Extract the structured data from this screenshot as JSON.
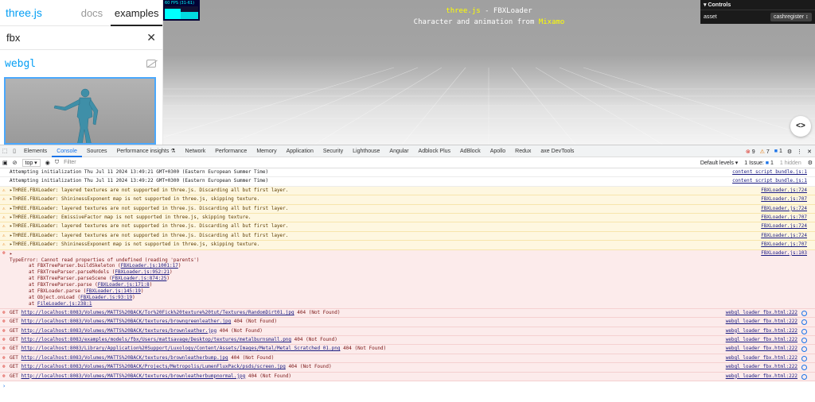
{
  "sidebar": {
    "brand": "three.js",
    "tabs": {
      "docs": "docs",
      "examples": "examples"
    },
    "search_value": "fbx",
    "clear_icon": "close-icon",
    "category": "webgl"
  },
  "viewport": {
    "title_brand": "three.js",
    "title_rest": " - FBXLoader",
    "subtitle_prefix": "Character and animation from ",
    "subtitle_link": "Mixamo",
    "stats": "60 FPS (31-61)",
    "gui": {
      "title": "Controls",
      "label": "asset",
      "value": "cashregister ↕"
    },
    "code_button": "<>"
  },
  "devtools": {
    "tabs": [
      "Elements",
      "Console",
      "Sources",
      "Performance insights ⚗",
      "Network",
      "Performance",
      "Memory",
      "Application",
      "Security",
      "Lighthouse",
      "Angular",
      "Adblock Plus",
      "AdBlock",
      "Apollo",
      "Redux",
      "axe DevTools"
    ],
    "active_tab": "Console",
    "error_count": "9",
    "warning_count": "7",
    "info_count": "1",
    "filterbar": {
      "context": "top ▾",
      "filter_placeholder": "Filter",
      "levels": "Default levels ▾",
      "issues": "1 Issue:",
      "issues_count": "1",
      "hidden": "1 hidden"
    },
    "logs": [
      {
        "text": "Attempting initialization Thu Jul 11 2024 13:49:21 GMT+0300 (Eastern European Summer Time)",
        "src": "content_script_bundle.js:1"
      },
      {
        "text": "Attempting initialization Thu Jul 11 2024 13:49:22 GMT+0300 (Eastern European Summer Time)",
        "src": "content_script_bundle.js:1"
      }
    ],
    "warnings": [
      {
        "text": "▸THREE.FBXLoader: layered textures are not supported in three.js. Discarding all but first layer.",
        "src": "FBXLoader.js:724"
      },
      {
        "text": "▸THREE.FBXLoader: ShininessExponent map is not supported in three.js, skipping texture.",
        "src": "FBXLoader.js:707"
      },
      {
        "text": "▸THREE.FBXLoader: layered textures are not supported in three.js. Discarding all but first layer.",
        "src": "FBXLoader.js:724"
      },
      {
        "text": "▸THREE.FBXLoader: EmissiveFactor map is not supported in three.js, skipping texture.",
        "src": "FBXLoader.js:707"
      },
      {
        "text": "▸THREE.FBXLoader: layered textures are not supported in three.js. Discarding all but first layer.",
        "src": "FBXLoader.js:724"
      },
      {
        "text": "▸THREE.FBXLoader: layered textures are not supported in three.js. Discarding all but first layer.",
        "src": "FBXLoader.js:724"
      },
      {
        "text": "▸THREE.FBXLoader: ShininessExponent map is not supported in three.js, skipping texture.",
        "src": "FBXLoader.js:707"
      }
    ],
    "type_error": {
      "arrow": "▸",
      "src": "FBXLoader.js:103",
      "message": "TypeError: Cannot read properties of undefined (reading 'parents')",
      "trace": [
        {
          "pre": "at FBXTreeParser.buildSkeleton (",
          "link": "FBXLoader.js:1001:17",
          "post": ")"
        },
        {
          "pre": "at FBXTreeParser.parseModels (",
          "link": "FBXLoader.js:952:21",
          "post": ")"
        },
        {
          "pre": "at FBXTreeParser.parseScene (",
          "link": "FBXLoader.js:874:25",
          "post": ")"
        },
        {
          "pre": "at FBXTreeParser.parse (",
          "link": "FBXLoader.js:171:8",
          "post": ")"
        },
        {
          "pre": "at FBXLoader.parse (",
          "link": "FBXLoader.js:145:19",
          "post": ")"
        },
        {
          "pre": "at Object.onLoad (",
          "link": "FBXLoader.js:93:19",
          "post": ")"
        },
        {
          "pre": "at ",
          "link": "FileLoader.js:238:1",
          "post": ""
        }
      ]
    },
    "network_errors": [
      {
        "method": "GET",
        "url": "http://localhost:8083/Volumes/MATTS%20BACK/Tor%20Fick%20texture%20tut/Textures/RandomDirt01.jpg",
        "status": "404 (Not Found)",
        "src": "webgl_loader_fbx.html:222"
      },
      {
        "method": "GET",
        "url": "http://localhost:8083/Volumes/MATTS%20BACK/textures/browngreenleather.jpg",
        "status": "404 (Not Found)",
        "src": "webgl_loader_fbx.html:222"
      },
      {
        "method": "GET",
        "url": "http://localhost:8083/Volumes/MATTS%20BACK/textures/brownleather.jpg",
        "status": "404 (Not Found)",
        "src": "webgl_loader_fbx.html:222"
      },
      {
        "method": "GET",
        "url": "http://localhost:8083/examples/models/fbx/Users/mattsavage/Desktop/textures/metalburnsmall.png",
        "status": "404 (Not Found)",
        "src": "webgl_loader_fbx.html:222"
      },
      {
        "method": "GET",
        "url": "http://localhost:8083/Library/Application%20Support/Luxology/Content/Assets/Images/Metal/Metal_Scratched_01.png",
        "status": "404 (Not Found)",
        "src": "webgl_loader_fbx.html:222"
      },
      {
        "method": "GET",
        "url": "http://localhost:8083/Volumes/MATTS%20BACK/textures/brownleatherbump.jpg",
        "status": "404 (Not Found)",
        "src": "webgl_loader_fbx.html:222"
      },
      {
        "method": "GET",
        "url": "http://localhost:8083/Volumes/MATTS%20BACK/Projects/Metropolis/LumenFluxPack/psds/screen.jpg",
        "status": "404 (Not Found)",
        "src": "webgl_loader_fbx.html:222"
      },
      {
        "method": "GET",
        "url": "http://localhost:8083/Volumes/MATTS%20BACK/textures/brownleatherbumpnormal.jpg",
        "status": "404 (Not Found)",
        "src": "webgl_loader_fbx.html:222"
      }
    ],
    "prompt": "›"
  }
}
